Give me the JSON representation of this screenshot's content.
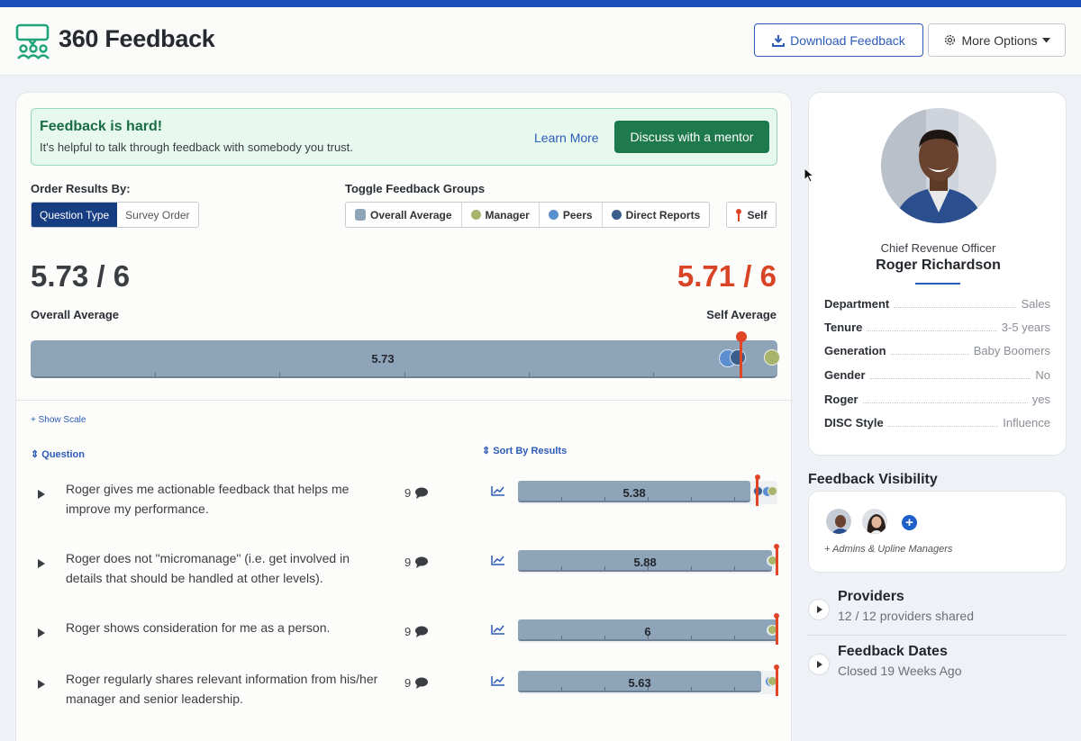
{
  "app": {
    "title": "360 Feedback"
  },
  "header": {
    "download_label": "Download Feedback",
    "more_label": "More Options"
  },
  "banner": {
    "title": "Feedback is hard!",
    "text": "It's helpful to talk through feedback with somebody you trust.",
    "learn_more": "Learn More",
    "mentor_button": "Discuss with a mentor"
  },
  "order": {
    "label": "Order Results By:",
    "options": [
      "Question Type",
      "Survey Order"
    ],
    "selected": "Question Type"
  },
  "toggle": {
    "label": "Toggle Feedback Groups",
    "groups": [
      {
        "label": "Overall Average",
        "color": "#8ea4b8"
      },
      {
        "label": "Manager",
        "color": "#a8b36c"
      },
      {
        "label": "Peers",
        "color": "#5b8fd0"
      },
      {
        "label": "Direct Reports",
        "color": "#3a5e8c"
      }
    ],
    "self_label": "Self",
    "self_color": "#e04626"
  },
  "summary": {
    "overall_score": "5.73 / 6",
    "overall_label": "Overall Average",
    "self_score": "5.71 / 6",
    "self_label": "Self Average",
    "bar_value": "5.73",
    "max": 6,
    "overall": 5.73,
    "self": 5.71,
    "peers": 5.6,
    "direct_reports": 5.68,
    "manager": 5.96
  },
  "list": {
    "show_scale": "+ Show Scale",
    "question_header": "Question",
    "sort_header": "Sort By Results",
    "rows": [
      {
        "text": "Roger gives me actionable feedback that helps me improve my performance.",
        "count": "9",
        "value_label": "5.38",
        "value": 5.38,
        "self": 5.54,
        "peers": 5.78,
        "direct_reports": 5.55,
        "manager": 5.95
      },
      {
        "text": "Roger does not \"micromanage\" (i.e. get involved in details that should be handled at other levels).",
        "count": "9",
        "value_label": "5.88",
        "value": 5.88,
        "self": 6.0,
        "peers": 5.93,
        "direct_reports": 5.91,
        "manager": 5.97
      },
      {
        "text": "Roger shows consideration for me as a person.",
        "count": "9",
        "value_label": "6",
        "value": 6.0,
        "self": 6.0,
        "peers": 5.98,
        "direct_reports": 5.98,
        "manager": 5.98
      },
      {
        "text": "Roger regularly shares relevant information from his/her manager and senior leadership.",
        "count": "9",
        "value_label": "5.63",
        "value": 5.63,
        "self": 6.0,
        "peers": 5.84,
        "direct_reports": 5.88,
        "manager": 5.95
      }
    ]
  },
  "profile": {
    "role": "Chief Revenue Officer",
    "name": "Roger Richardson",
    "attributes": [
      {
        "key": "Department",
        "value": "Sales"
      },
      {
        "key": "Tenure",
        "value": "3-5 years"
      },
      {
        "key": "Generation",
        "value": "Baby Boomers"
      },
      {
        "key": "Gender",
        "value": "No"
      },
      {
        "key": "Roger",
        "value": "yes"
      },
      {
        "key": "DISC Style",
        "value": "Influence"
      }
    ]
  },
  "visibility": {
    "title": "Feedback Visibility",
    "note": "+ Admins & Upline Managers"
  },
  "providers": {
    "title": "Providers",
    "subtitle": "12 / 12 providers shared"
  },
  "dates": {
    "title": "Feedback Dates",
    "subtitle": "Closed 19 Weeks Ago"
  }
}
